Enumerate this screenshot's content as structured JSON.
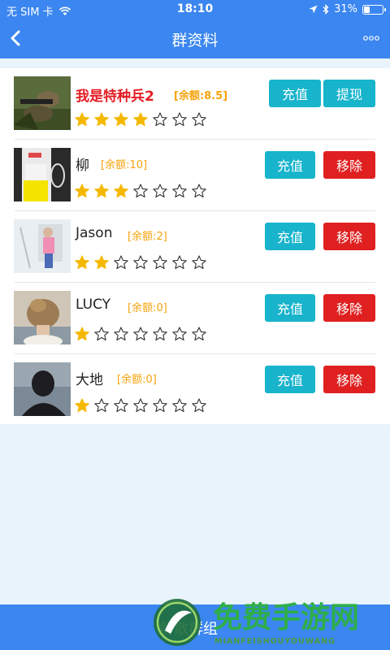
{
  "status": {
    "carrier": "无 SIM 卡",
    "time": "18:10",
    "battery": "31%",
    "battery_level": 0.31
  },
  "nav": {
    "title": "群资料",
    "back_icon": "chevron-left-icon",
    "more_icon": "more-dots-icon"
  },
  "members": [
    {
      "name": "我是特种兵2",
      "balance": "[余额:8.5]",
      "rating": 4,
      "max_rating": 7,
      "recharge": "充值",
      "action": "提现",
      "owner": true
    },
    {
      "name": "柳",
      "balance": "[余额:10]",
      "rating": 3,
      "max_rating": 7,
      "recharge": "充值",
      "action": "移除",
      "owner": false
    },
    {
      "name": "Jason",
      "balance": "[余额:2]",
      "rating": 2,
      "max_rating": 7,
      "recharge": "充值",
      "action": "移除",
      "owner": false
    },
    {
      "name": "LUCY",
      "balance": "[余额:0]",
      "rating": 1,
      "max_rating": 7,
      "recharge": "充值",
      "action": "移除",
      "owner": false
    },
    {
      "name": "大地",
      "balance": "[余额:0]",
      "rating": 1,
      "max_rating": 7,
      "recharge": "充值",
      "action": "移除",
      "owner": false
    }
  ],
  "bottom": {
    "label": "解散群组"
  },
  "watermark": {
    "title": "免费手游网",
    "subtitle": "MIANFEISHOUYOUWANG"
  },
  "colors": {
    "primary": "#3b86f0",
    "teal": "#17b4cc",
    "red": "#e02020",
    "gold": "#f5b800",
    "balance": "#f5a30a"
  }
}
